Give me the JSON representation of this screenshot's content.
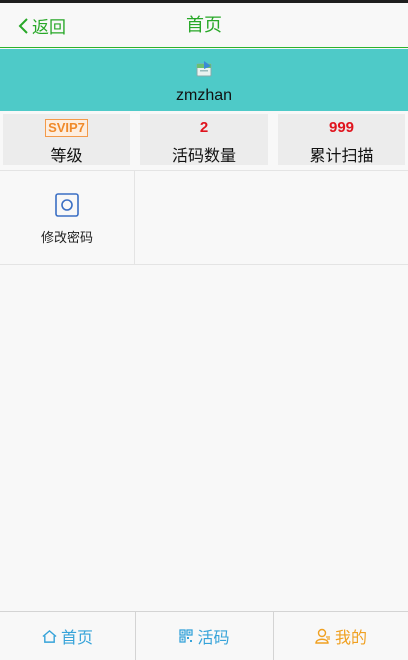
{
  "header": {
    "back_label": "返回",
    "title": "首页"
  },
  "profile": {
    "username": "zmzhan"
  },
  "stats": [
    {
      "value": "SVIP7",
      "label": "等级"
    },
    {
      "value": "2",
      "label": "活码数量"
    },
    {
      "value": "999",
      "label": "累计扫描"
    }
  ],
  "menu": [
    {
      "label": "修改密码",
      "icon": "square-circle-icon"
    }
  ],
  "tabbar": [
    {
      "label": "首页",
      "icon": "home-icon",
      "color": "#36a3d9"
    },
    {
      "label": "活码",
      "icon": "qrcode-icon",
      "color": "#36a3d9"
    },
    {
      "label": "我的",
      "icon": "user-icon",
      "color": "#f0a020"
    }
  ],
  "colors": {
    "accent_green": "#28a828",
    "profile_bg": "#4ecac8",
    "stat_value": "#e0141e"
  }
}
